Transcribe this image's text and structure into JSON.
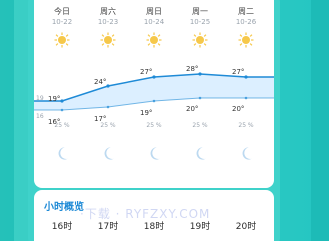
{
  "forecast": {
    "days": [
      "今日",
      "周六",
      "周日",
      "周一",
      "周二"
    ],
    "dates": [
      "10-22",
      "10-23",
      "10-24",
      "10-25",
      "10-26"
    ],
    "highs": [
      "19°",
      "24°",
      "27°",
      "28°",
      "27°"
    ],
    "lows": [
      "16°",
      "17°",
      "19°",
      "20°",
      "20°"
    ],
    "high_values": [
      19,
      24,
      27,
      28,
      27
    ],
    "low_values": [
      16,
      17,
      19,
      20,
      20
    ],
    "precip": [
      "25 %",
      "25 %",
      "25 %",
      "25 %",
      "25 %"
    ],
    "axis_left_top": "19",
    "axis_left_bottom": "16"
  },
  "hourly": {
    "title": "小时概览",
    "hours": [
      "16时",
      "17时",
      "18时",
      "19时",
      "20时"
    ]
  },
  "watermark": "·下载 · RYFZXY.COM",
  "colors": {
    "accent": "#1e8ad6",
    "line": "#1e8ad6",
    "fill": "#dcefff",
    "teal": "#3fd2ca"
  },
  "icons": {
    "day": "sun-icon",
    "night": "moon-icon"
  }
}
